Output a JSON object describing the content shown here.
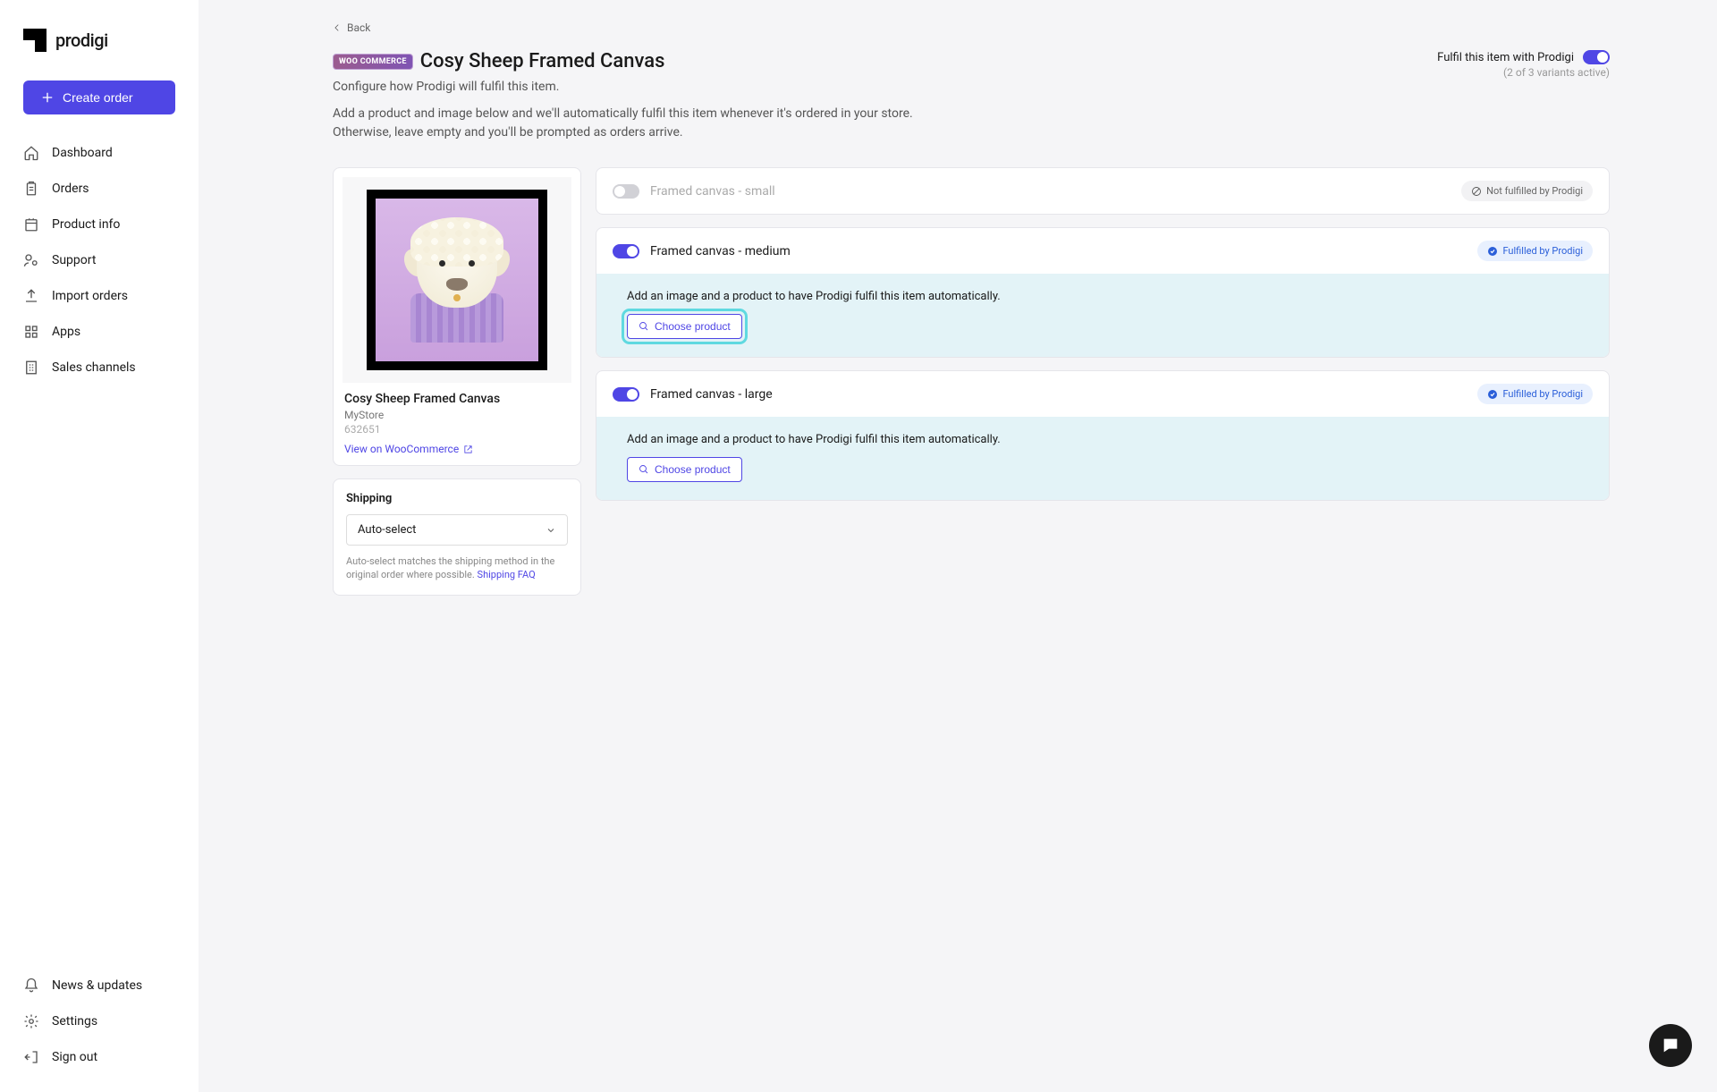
{
  "brand": "prodigi",
  "create_order": "Create order",
  "nav": {
    "dashboard": "Dashboard",
    "orders": "Orders",
    "product_info": "Product info",
    "support": "Support",
    "import_orders": "Import orders",
    "apps": "Apps",
    "sales_channels": "Sales channels",
    "news": "News & updates",
    "settings": "Settings",
    "sign_out": "Sign out"
  },
  "back": "Back",
  "woo_badge": "WOO COMMERCE",
  "page_title": "Cosy Sheep Framed Canvas",
  "subtitle": "Configure how Prodigi will fulfil this item.",
  "desc1": "Add a product and image below and we'll automatically fulfil this item whenever it's ordered in your store.",
  "desc2": "Otherwise, leave empty and you'll be prompted as orders arrive.",
  "fulfil": {
    "label": "Fulfil this item with Prodigi",
    "sub": "(2 of 3 variants active)"
  },
  "product": {
    "name": "Cosy Sheep Framed Canvas",
    "store": "MyStore",
    "id": "632651",
    "view_link": "View on WooCommerce"
  },
  "shipping": {
    "title": "Shipping",
    "selected": "Auto-select",
    "note": "Auto-select matches the shipping method in the original order where possible. ",
    "faq": "Shipping FAQ"
  },
  "variants": [
    {
      "name": "Framed canvas - small",
      "enabled": false,
      "badge": "Not fulfilled by Prodigi",
      "show_body": false,
      "highlight": false
    },
    {
      "name": "Framed canvas - medium",
      "enabled": true,
      "badge": "Fulfilled by Prodigi",
      "show_body": true,
      "highlight": true
    },
    {
      "name": "Framed canvas - large",
      "enabled": true,
      "badge": "Fulfilled by Prodigi",
      "show_body": true,
      "highlight": false
    }
  ],
  "body_text": "Add an image and a product to have Prodigi fulfil this item automatically.",
  "choose_product": "Choose product"
}
